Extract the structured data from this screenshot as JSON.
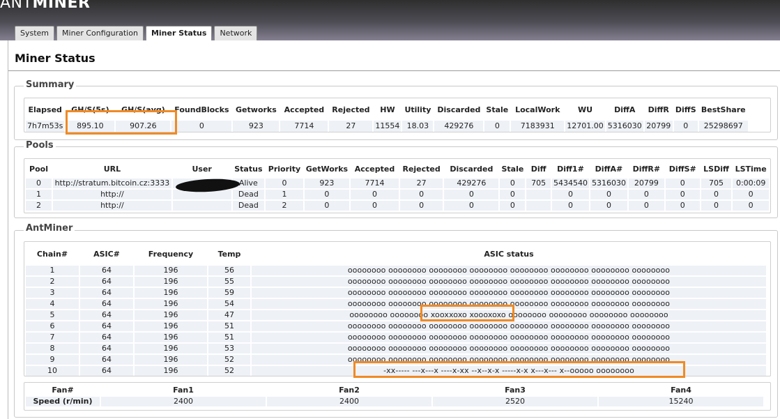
{
  "brand": {
    "prefix": "ANT",
    "suffix": "MINER"
  },
  "tabs": [
    "System",
    "Miner Configuration",
    "Miner Status",
    "Network"
  ],
  "page_title": "Miner Status",
  "summary": {
    "legend": "Summary",
    "headers": [
      "Elapsed",
      "GH/S(5s)",
      "GH/S(avg)",
      "FoundBlocks",
      "Getworks",
      "Accepted",
      "Rejected",
      "HW",
      "Utility",
      "Discarded",
      "Stale",
      "LocalWork",
      "WU",
      "DiffA",
      "DiffR",
      "DiffS",
      "BestShare"
    ],
    "row": [
      "7h7m53s",
      "895.10",
      "907.26",
      "0",
      "923",
      "7714",
      "27",
      "11554",
      "18.03",
      "429276",
      "0",
      "7183931",
      "12701.00",
      "5316030",
      "20799",
      "0",
      "25298697"
    ]
  },
  "pools": {
    "legend": "Pools",
    "headers": [
      "Pool",
      "URL",
      "User",
      "Status",
      "Priority",
      "GetWorks",
      "Accepted",
      "Rejected",
      "Discarded",
      "Stale",
      "Diff",
      "Diff1#",
      "DiffA#",
      "DiffR#",
      "DiffS#",
      "LSDiff",
      "LSTime"
    ],
    "rows": [
      [
        "0",
        "http://stratum.bitcoin.cz:3333",
        "",
        "Alive",
        "0",
        "923",
        "7714",
        "27",
        "429276",
        "0",
        "705",
        "5434540",
        "5316030",
        "20799",
        "0",
        "705",
        "0:00:09"
      ],
      [
        "1",
        "http://",
        "",
        "Dead",
        "1",
        "0",
        "0",
        "0",
        "0",
        "0",
        "",
        "0",
        "0",
        "0",
        "0",
        "0",
        "0"
      ],
      [
        "2",
        "http://",
        "",
        "Dead",
        "2",
        "0",
        "0",
        "0",
        "0",
        "0",
        "",
        "0",
        "0",
        "0",
        "0",
        "0",
        "0"
      ]
    ]
  },
  "antminer": {
    "legend": "AntMiner",
    "headers": [
      "Chain#",
      "ASIC#",
      "Frequency",
      "Temp",
      "ASIC status"
    ],
    "rows": [
      [
        "1",
        "64",
        "196",
        "56",
        "oooooooo oooooooo oooooooo oooooooo oooooooo oooooooo oooooooo oooooooo"
      ],
      [
        "2",
        "64",
        "196",
        "55",
        "oooooooo oooooooo oooooooo oooooooo oooooooo oooooooo oooooooo oooooooo"
      ],
      [
        "3",
        "64",
        "196",
        "59",
        "oooooooo oooooooo oooooooo oooooooo oooooooo oooooooo oooooooo oooooooo"
      ],
      [
        "4",
        "64",
        "196",
        "54",
        "oooooooo oooooooo oooooooo oooooooo oooooooo oooooooo oooooooo oooooooo"
      ],
      [
        "5",
        "64",
        "196",
        "47",
        "oooooooo oooooooo xooxxoxo xoooxoxo oooooooo oooooooo oooooooo oooooooo"
      ],
      [
        "6",
        "64",
        "196",
        "51",
        "oooooooo oooooooo oooooooo oooooooo oooooooo oooooooo oooooooo oooooooo"
      ],
      [
        "7",
        "64",
        "196",
        "51",
        "oooooooo oooooooo oooooooo oooooooo oooooooo oooooooo oooooooo oooooooo"
      ],
      [
        "8",
        "64",
        "196",
        "53",
        "oooooooo oooooooo oooooooo oooooooo oooooooo oooooooo oooooooo oooooooo"
      ],
      [
        "9",
        "64",
        "196",
        "52",
        "oooooooo oooooooo oooooooo oooooooo oooooooo oooooooo oooooooo oooooooo"
      ],
      [
        "10",
        "64",
        "196",
        "52",
        "-xx----- ---x---x ----x-xx --x--x-x -----x-x x---x--- x--ooooo oooooooo"
      ]
    ],
    "fan_headers": [
      "Fan#",
      "Fan1",
      "Fan2",
      "Fan3",
      "Fan4"
    ],
    "fan_row": [
      "Speed (r/min)",
      "2400",
      "2400",
      "2520",
      "15240"
    ]
  },
  "colors": {
    "highlight": "#f08a24",
    "cell_bg": "#eef1f6",
    "header_bg": "#4e4d55"
  }
}
